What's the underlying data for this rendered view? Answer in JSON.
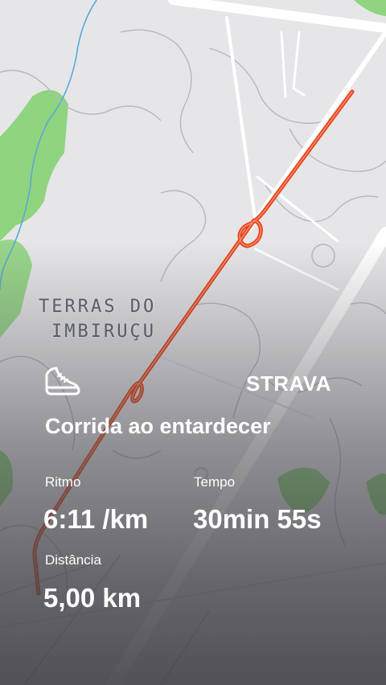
{
  "map": {
    "place_label_line1": "TERRAS DO",
    "place_label_line2": "IMBIRUÇU",
    "route_color": "#e8451c",
    "park_color": "#8fd47f",
    "water_color": "#5aa8d8"
  },
  "activity": {
    "icon": "running-shoe-icon",
    "brand": "STRAVA",
    "title": "Corrida ao entardecer",
    "stats": {
      "pace_label": "Ritmo",
      "pace_value": "6:11 /km",
      "time_label": "Tempo",
      "time_value": "30min 55s",
      "distance_label": "Distância",
      "distance_value": "5,00 km"
    }
  }
}
